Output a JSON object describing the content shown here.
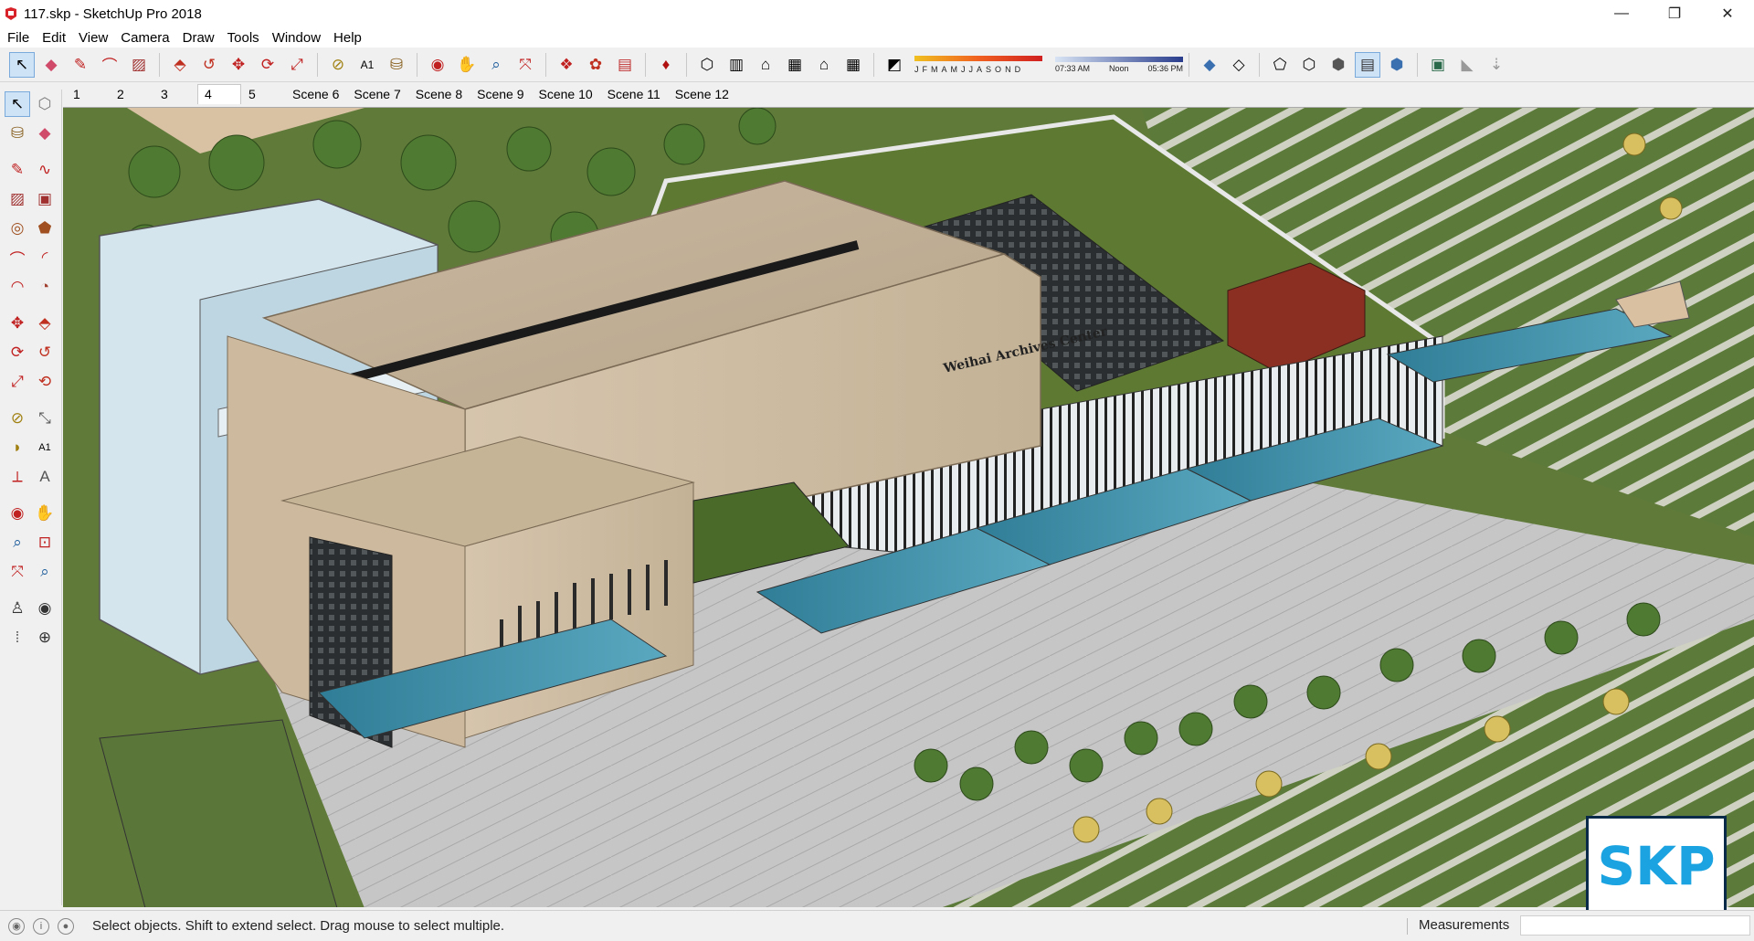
{
  "window": {
    "title": "117.skp - SketchUp Pro 2018",
    "controls": {
      "minimize": "—",
      "restore": "❐",
      "close": "✕"
    }
  },
  "menu": [
    "File",
    "Edit",
    "View",
    "Camera",
    "Draw",
    "Tools",
    "Window",
    "Help"
  ],
  "toolbar": {
    "tools": [
      "select-icon",
      "eraser-icon",
      "pencil-icon",
      "arc-icon",
      "rectangle-icon",
      "push-pull-icon",
      "follow-me-icon",
      "move-icon",
      "rotate-icon",
      "scale-icon",
      "tape-measure-icon",
      "text-icon",
      "paint-bucket-icon",
      "orbit-icon",
      "pan-icon",
      "zoom-icon",
      "zoom-extents-icon",
      "warehouse-icon",
      "extension-warehouse-icon",
      "layout-icon",
      "ruby-icon",
      "iso-view-icon",
      "top-view-icon",
      "front-view-icon",
      "right-view-icon",
      "back-view-icon",
      "left-view-icon",
      "shadows-toggle-icon"
    ],
    "shadow": {
      "months": [
        "J",
        "F",
        "M",
        "A",
        "M",
        "J",
        "J",
        "A",
        "S",
        "O",
        "N",
        "D"
      ],
      "time_start": "07:33 AM",
      "time_mid": "Noon",
      "time_end": "05:36 PM"
    },
    "style_tools": [
      "xray-icon",
      "back-edges-icon",
      "wireframe-icon",
      "hidden-line-icon",
      "shaded-icon",
      "shaded-textures-icon",
      "monochrome-icon",
      "section-plane-icon",
      "section-display-icon",
      "section-cut-icon"
    ]
  },
  "scenes": [
    "1",
    "2",
    "3",
    "4",
    "5",
    "Scene 6",
    "Scene 7",
    "Scene 8",
    "Scene 9",
    "Scene 10",
    "Scene 11",
    "Scene 12"
  ],
  "active_scene": "4",
  "model": {
    "sign_text": "Weihai Archives Center",
    "badge_text": "SKP"
  },
  "status": {
    "hint": "Select objects. Shift to extend select. Drag mouse to select multiple.",
    "measurements_label": "Measurements",
    "measurements_value": ""
  },
  "colors": {
    "lawn": "#5f7438",
    "stone": "#c9b8a0",
    "water": "#3d8fa8",
    "sky_glass": "#cfe1ea",
    "accent_red": "#8b2f22",
    "brand_blue": "#1aa3e0"
  }
}
